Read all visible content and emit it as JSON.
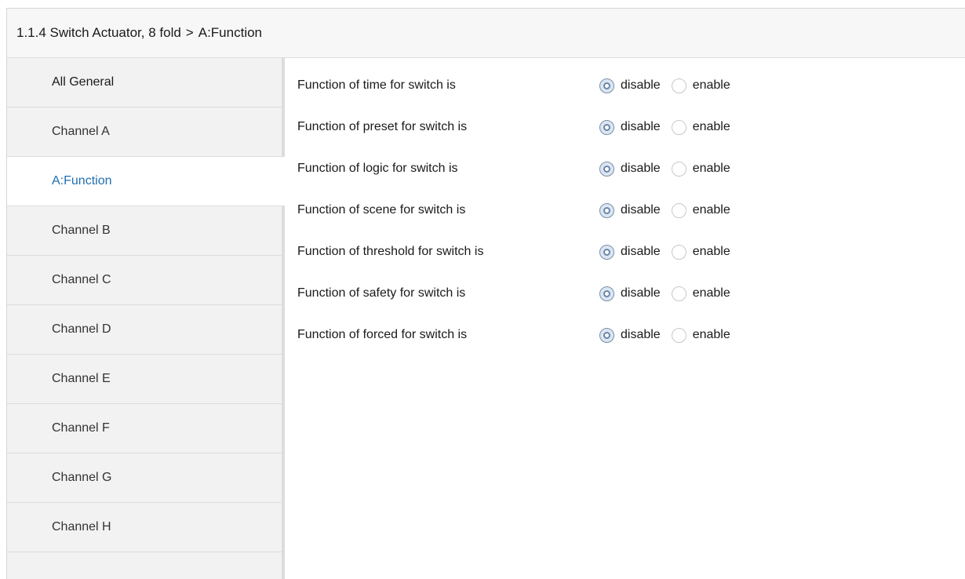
{
  "header": {
    "device": "1.1.4 Switch Actuator, 8 fold",
    "separator": ">",
    "current": "A:Function"
  },
  "sidebar": {
    "items": [
      {
        "label": "All General"
      },
      {
        "label": "Channel A"
      },
      {
        "label": "A:Function"
      },
      {
        "label": "Channel B"
      },
      {
        "label": "Channel C"
      },
      {
        "label": "Channel D"
      },
      {
        "label": "Channel E"
      },
      {
        "label": "Channel F"
      },
      {
        "label": "Channel G"
      },
      {
        "label": "Channel H"
      }
    ],
    "active_index": 2
  },
  "options": {
    "disable": "disable",
    "enable": "enable"
  },
  "params": [
    {
      "label": "Function of time for switch is",
      "value": "disable"
    },
    {
      "label": "Function of preset for switch is",
      "value": "disable"
    },
    {
      "label": "Function of logic for switch is",
      "value": "disable"
    },
    {
      "label": "Function of scene for switch is",
      "value": "disable"
    },
    {
      "label": "Function of threshold for switch is",
      "value": "disable"
    },
    {
      "label": "Function of safety for switch is",
      "value": "disable"
    },
    {
      "label": "Function of forced for switch is",
      "value": "disable"
    }
  ],
  "colors": {
    "active_nav_text": "#1f6fb2",
    "radio_checked_fill": "#dbe6f3",
    "radio_checked_ring": "#6c86a8"
  }
}
